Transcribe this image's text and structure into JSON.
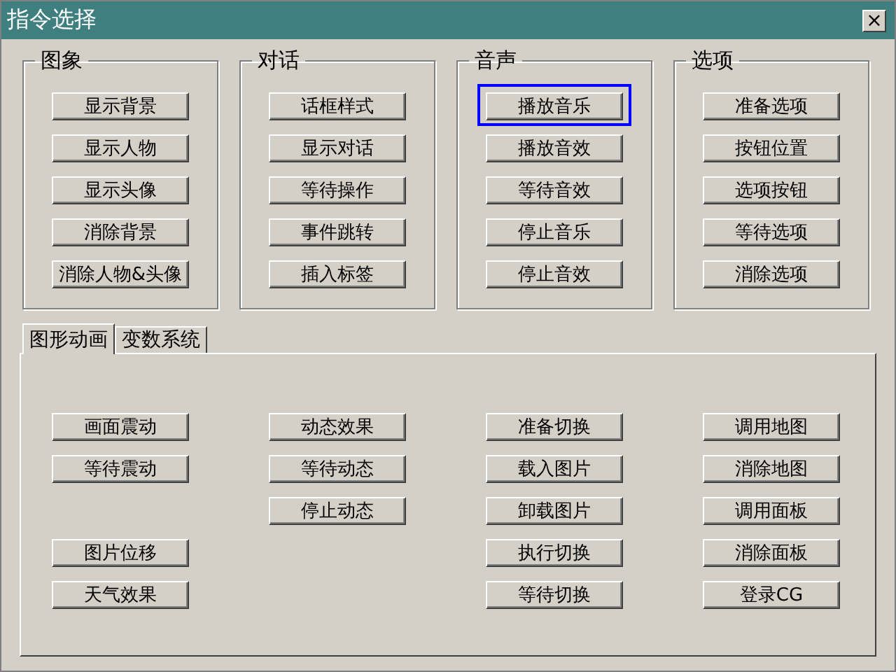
{
  "window": {
    "title": "指令选择",
    "close": "×"
  },
  "groups": [
    {
      "title": "图象",
      "buttons": [
        {
          "label": "显示背景",
          "focused": false
        },
        {
          "label": "显示人物",
          "focused": false
        },
        {
          "label": "显示头像",
          "focused": false
        },
        {
          "label": "消除背景",
          "focused": false
        },
        {
          "label": "消除人物&头像",
          "focused": false
        }
      ]
    },
    {
      "title": "对话",
      "buttons": [
        {
          "label": "话框样式",
          "focused": false
        },
        {
          "label": "显示对话",
          "focused": false
        },
        {
          "label": "等待操作",
          "focused": false
        },
        {
          "label": "事件跳转",
          "focused": false
        },
        {
          "label": "插入标签",
          "focused": false
        }
      ]
    },
    {
      "title": "音声",
      "buttons": [
        {
          "label": "播放音乐",
          "focused": true
        },
        {
          "label": "播放音效",
          "focused": false
        },
        {
          "label": "等待音效",
          "focused": false
        },
        {
          "label": "停止音乐",
          "focused": false
        },
        {
          "label": "停止音效",
          "focused": false
        }
      ]
    },
    {
      "title": "选项",
      "buttons": [
        {
          "label": "准备选项",
          "focused": false
        },
        {
          "label": "按钮位置",
          "focused": false
        },
        {
          "label": "选项按钮",
          "focused": false
        },
        {
          "label": "等待选项",
          "focused": false
        },
        {
          "label": "消除选项",
          "focused": false
        }
      ]
    }
  ],
  "tabs": [
    {
      "label": "图形动画",
      "selected": true
    },
    {
      "label": "变数系统",
      "selected": false
    }
  ],
  "tab_page": {
    "rows": [
      [
        {
          "label": "画面震动"
        },
        {
          "label": "动态效果"
        },
        {
          "label": "准备切换"
        },
        {
          "label": "调用地图"
        }
      ],
      [
        {
          "label": "等待震动"
        },
        {
          "label": "等待动态"
        },
        {
          "label": "载入图片"
        },
        {
          "label": "消除地图"
        }
      ],
      [
        null,
        {
          "label": "停止动态"
        },
        {
          "label": "卸载图片"
        },
        {
          "label": "调用面板"
        }
      ],
      [
        {
          "label": "图片位移"
        },
        null,
        {
          "label": "执行切换"
        },
        {
          "label": "消除面板"
        }
      ],
      [
        {
          "label": "天气效果"
        },
        null,
        {
          "label": "等待切换"
        },
        {
          "label": "登录CG"
        }
      ]
    ]
  }
}
